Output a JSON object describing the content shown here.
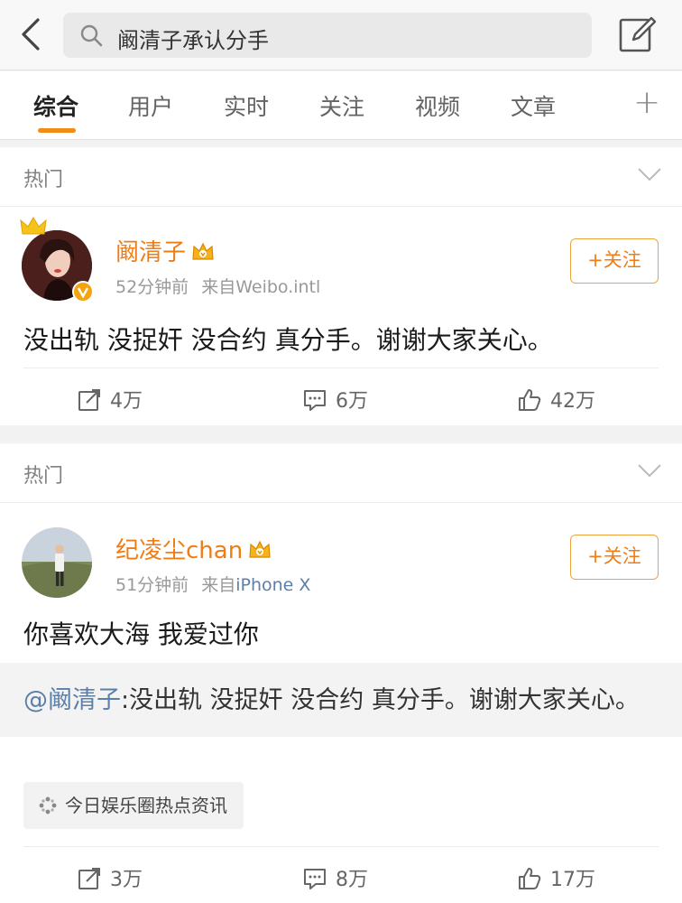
{
  "search": {
    "query": "阚清子承认分手"
  },
  "tabs": [
    {
      "label": "综合"
    },
    {
      "label": "用户"
    },
    {
      "label": "实时"
    },
    {
      "label": "关注"
    },
    {
      "label": "视频"
    },
    {
      "label": "文章"
    }
  ],
  "tab_more": "+",
  "posts": [
    {
      "section": "热门",
      "user": "阚清子",
      "time": "52分钟前",
      "source_prefix": "来自",
      "source": "Weibo.intl",
      "follow_label": "+关注",
      "text": "没出轨 没捉奸 没合约 真分手。谢谢大家关心。",
      "reposts": "4万",
      "comments": "6万",
      "likes": "42万"
    },
    {
      "section": "热门",
      "user": "纪凌尘chan",
      "time": "51分钟前",
      "source_prefix": "来自",
      "source": "iPhone X",
      "follow_label": "+关注",
      "text": "你喜欢大海 我爱过你",
      "quote_mention": "@阚清子",
      "quote_text": ":没出轨 没捉奸 没合约 真分手。谢谢大家关心。",
      "topic_chip": "今日娱乐圈热点资讯",
      "reposts": "3万",
      "comments": "8万",
      "likes": "17万"
    }
  ],
  "colors": {
    "accent": "#f07d14",
    "link": "#5b7fa8",
    "tab_indicator": "#f28b17"
  }
}
